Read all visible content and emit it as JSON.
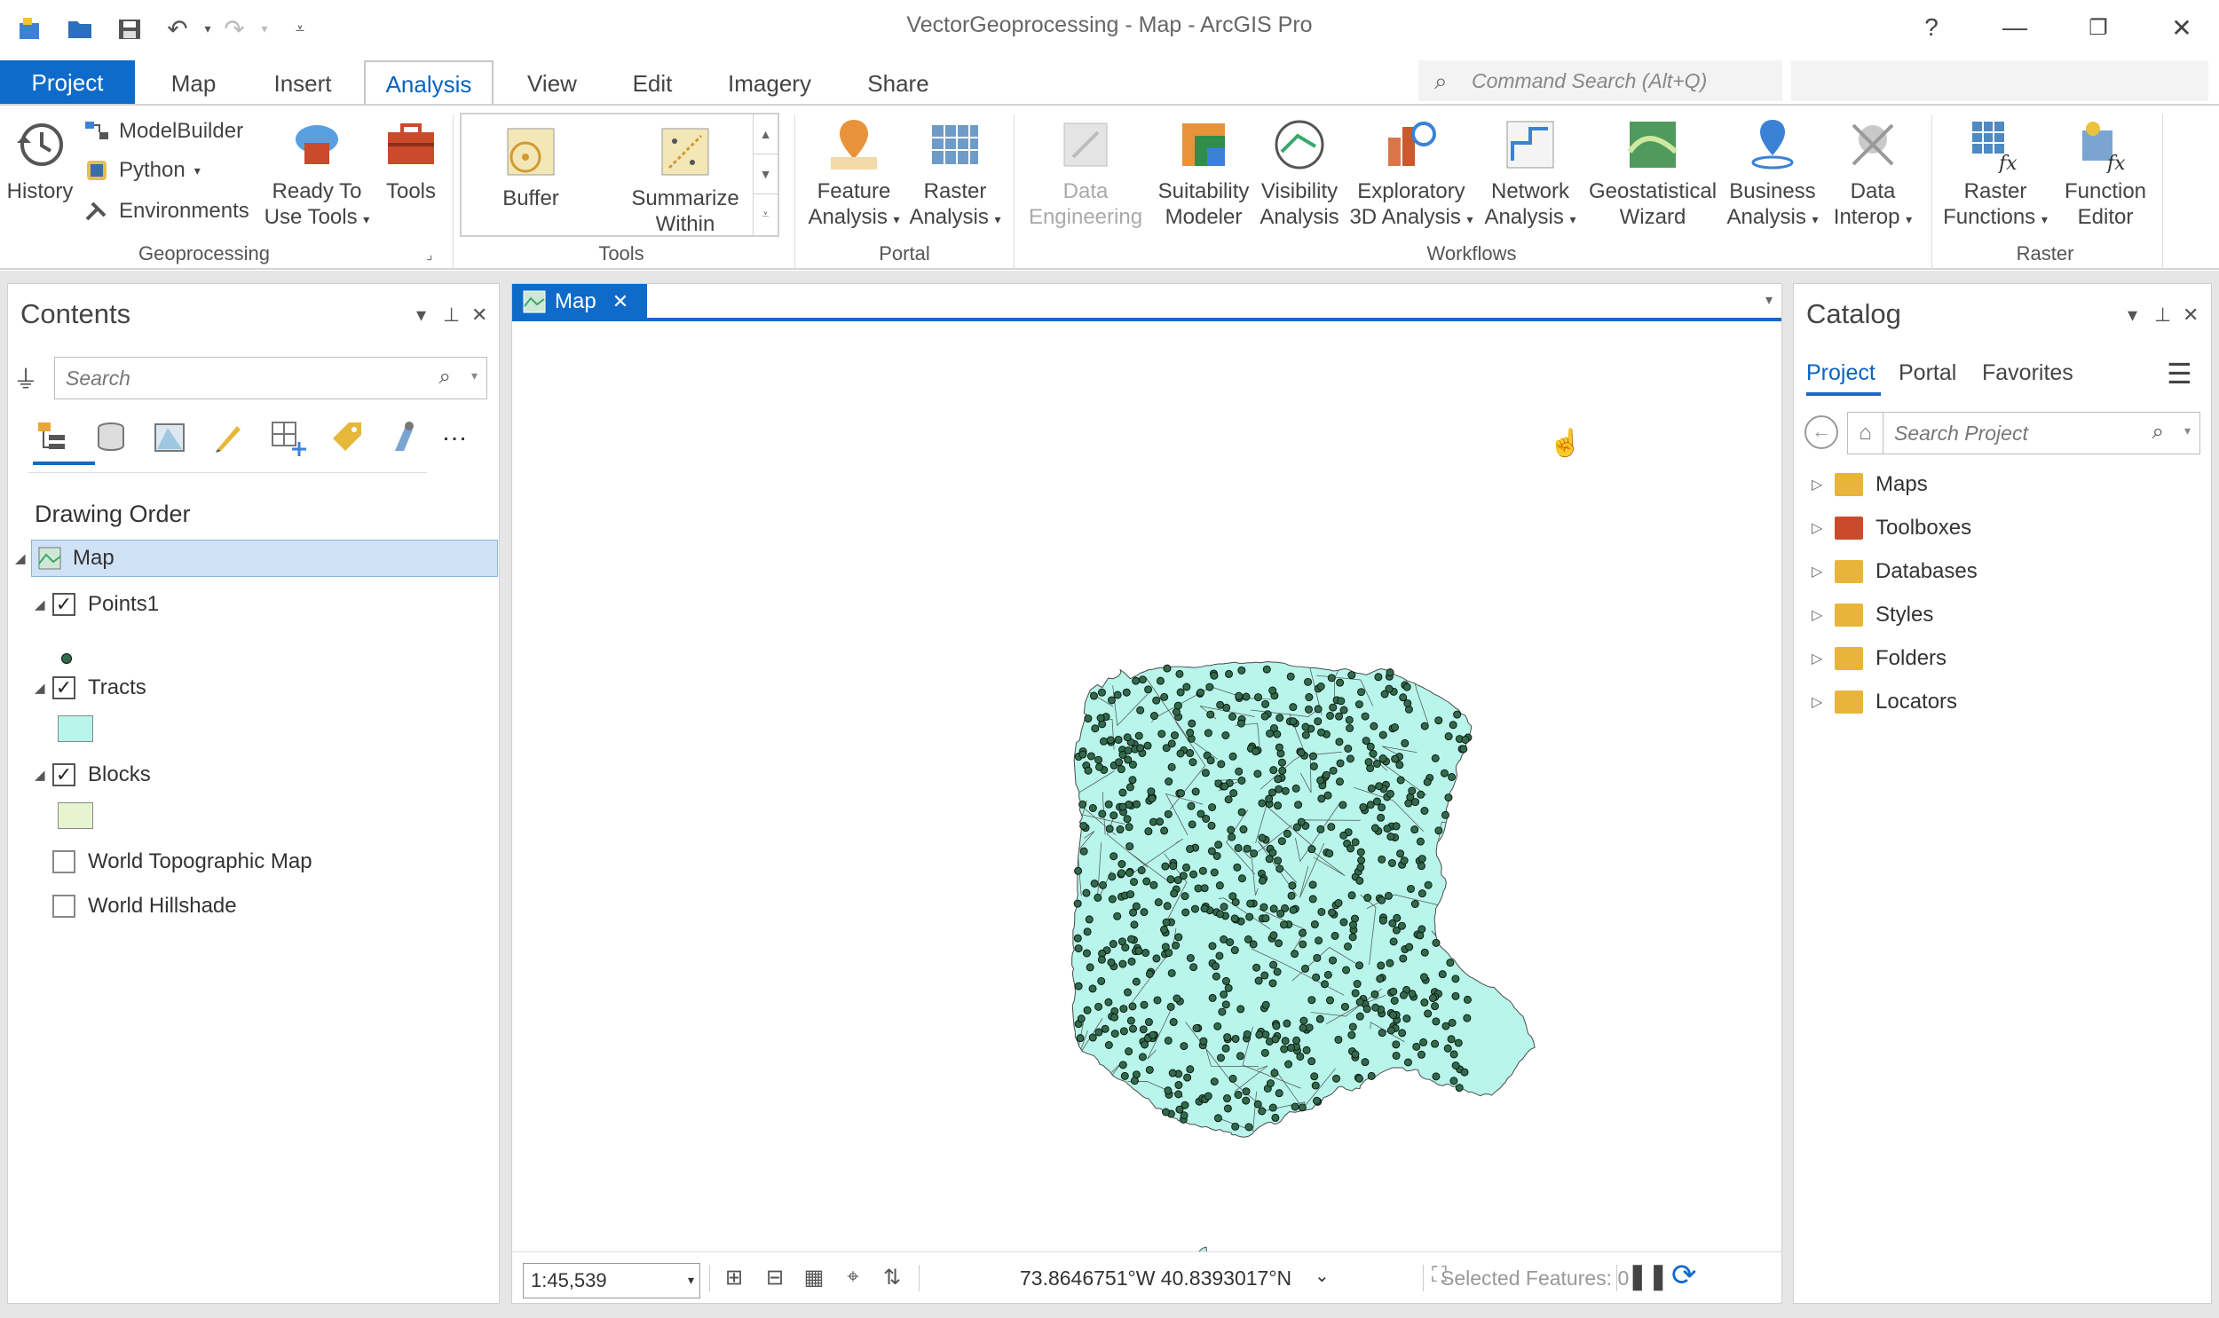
{
  "app": {
    "title": "VectorGeoprocessing - Map - ArcGIS Pro",
    "help": "?"
  },
  "ribbon_tabs": [
    "Project",
    "Map",
    "Insert",
    "Analysis",
    "View",
    "Edit",
    "Imagery",
    "Share"
  ],
  "command_search": {
    "placeholder": "Command Search (Alt+Q)"
  },
  "geoprocessing": {
    "history": "History",
    "modelbuilder": "ModelBuilder",
    "python": "Python",
    "environments": "Environments",
    "ready_to_use": [
      "Ready To",
      "Use Tools"
    ],
    "tools": "Tools",
    "group": "Geoprocessing"
  },
  "tools_gallery": {
    "buffer": "Buffer",
    "summarize": [
      "Summarize",
      "Within"
    ],
    "group": "Tools"
  },
  "portal": {
    "feature": [
      "Feature",
      "Analysis"
    ],
    "raster": [
      "Raster",
      "Analysis"
    ],
    "group": "Portal"
  },
  "workflows": {
    "items": [
      {
        "l1": "Data",
        "l2": "Engineering",
        "disabled": true
      },
      {
        "l1": "Suitability",
        "l2": "Modeler"
      },
      {
        "l1": "Visibility",
        "l2": "Analysis"
      },
      {
        "l1": "Exploratory",
        "l2": "3D Analysis"
      },
      {
        "l1": "Network",
        "l2": "Analysis"
      },
      {
        "l1": "Geostatistical",
        "l2": "Wizard"
      },
      {
        "l1": "Business",
        "l2": "Analysis"
      },
      {
        "l1": "Data",
        "l2": "Interop"
      }
    ],
    "group": "Workflows"
  },
  "raster": {
    "functions": [
      "Raster",
      "Functions"
    ],
    "editor": [
      "Function",
      "Editor"
    ],
    "group": "Raster"
  },
  "contents": {
    "title": "Contents",
    "search_placeholder": "Search",
    "heading": "Drawing Order",
    "map": "Map",
    "layers": [
      {
        "name": "Points1",
        "checked": true
      },
      {
        "name": "Tracts",
        "checked": true,
        "swatch": "#b8f5ea"
      },
      {
        "name": "Blocks",
        "checked": true,
        "swatch": "#e6f5cf"
      },
      {
        "name": "World Topographic Map",
        "checked": false
      },
      {
        "name": "World Hillshade",
        "checked": false
      }
    ]
  },
  "map_view": {
    "tab": "Map",
    "scale": "1:45,539",
    "coordinates": "73.8646751°W 40.8393017°N",
    "selected": "Selected Features: 0",
    "tract_fill": "#b8f5ea",
    "point_fill": "#2f6b4a"
  },
  "catalog": {
    "title": "Catalog",
    "tabs": [
      "Project",
      "Portal",
      "Favorites"
    ],
    "search_placeholder": "Search Project",
    "items": [
      "Maps",
      "Toolboxes",
      "Databases",
      "Styles",
      "Folders",
      "Locators"
    ]
  },
  "colors": {
    "accent": "#0f6bc9"
  }
}
